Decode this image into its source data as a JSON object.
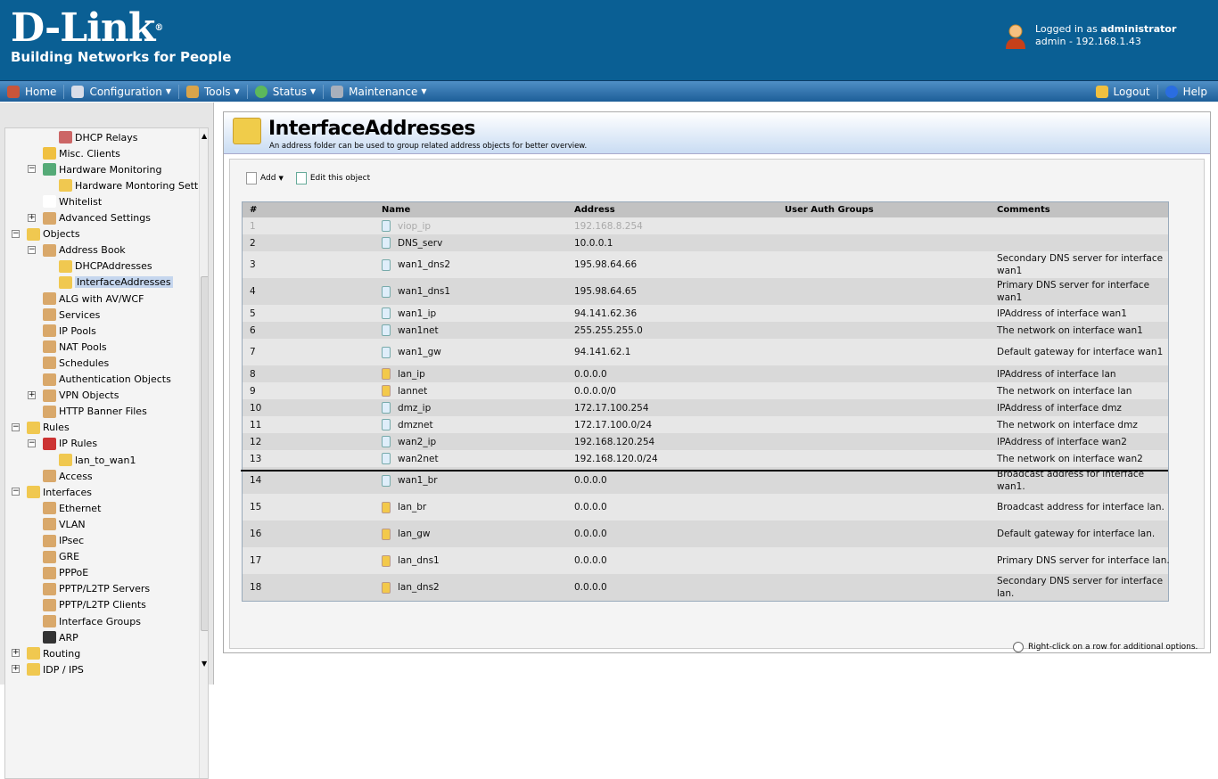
{
  "header": {
    "logo": "D-Link",
    "tagline": "Building Networks for People",
    "logged_in_prefix": "Logged in as ",
    "user": "administrator",
    "session": "admin - 192.168.1.43"
  },
  "nav": {
    "home": "Home",
    "configuration": "Configuration",
    "tools": "Tools",
    "status": "Status",
    "maintenance": "Maintenance",
    "logout": "Logout",
    "help": "Help"
  },
  "tree": [
    {
      "label": "DHCP Relays",
      "level": 3
    },
    {
      "label": "Misc. Clients",
      "level": 2
    },
    {
      "label": "Hardware Monitoring",
      "level": 2,
      "expander": "-"
    },
    {
      "label": "Hardware Montoring Settings",
      "level": 3
    },
    {
      "label": "Whitelist",
      "level": 2
    },
    {
      "label": "Advanced Settings",
      "level": 2,
      "expander": "+"
    },
    {
      "label": "Objects",
      "level": 1,
      "expander": "-"
    },
    {
      "label": "Address Book",
      "level": 2,
      "expander": "-"
    },
    {
      "label": "DHCPAddresses",
      "level": 3
    },
    {
      "label": "InterfaceAddresses",
      "level": 3,
      "selected": true
    },
    {
      "label": "ALG with AV/WCF",
      "level": 2
    },
    {
      "label": "Services",
      "level": 2
    },
    {
      "label": "IP Pools",
      "level": 2
    },
    {
      "label": "NAT Pools",
      "level": 2
    },
    {
      "label": "Schedules",
      "level": 2
    },
    {
      "label": "Authentication Objects",
      "level": 2
    },
    {
      "label": "VPN Objects",
      "level": 2,
      "expander": "+"
    },
    {
      "label": "HTTP Banner Files",
      "level": 2
    },
    {
      "label": "Rules",
      "level": 1,
      "expander": "-"
    },
    {
      "label": "IP Rules",
      "level": 2,
      "expander": "-"
    },
    {
      "label": "lan_to_wan1",
      "level": 3
    },
    {
      "label": "Access",
      "level": 2
    },
    {
      "label": "Interfaces",
      "level": 1,
      "expander": "-"
    },
    {
      "label": "Ethernet",
      "level": 2
    },
    {
      "label": "VLAN",
      "level": 2
    },
    {
      "label": "IPsec",
      "level": 2
    },
    {
      "label": "GRE",
      "level": 2
    },
    {
      "label": "PPPoE",
      "level": 2
    },
    {
      "label": "PPTP/L2TP Servers",
      "level": 2
    },
    {
      "label": "PPTP/L2TP Clients",
      "level": 2
    },
    {
      "label": "Interface Groups",
      "level": 2
    },
    {
      "label": "ARP",
      "level": 2
    },
    {
      "label": "Routing",
      "level": 1,
      "expander": "+"
    },
    {
      "label": "IDP / IPS",
      "level": 1,
      "expander": "+"
    }
  ],
  "page": {
    "title": "InterfaceAddresses",
    "description": "An address folder can be used to group related address objects for better overview.",
    "add": "Add",
    "edit": "Edit this object",
    "hint": "Right-click on a row for additional options."
  },
  "table": {
    "headers": [
      "#",
      "Name",
      "Address",
      "User Auth Groups",
      "Comments"
    ],
    "rows": [
      {
        "n": "1",
        "name": "viop_ip",
        "address": "192.168.8.254",
        "groups": "",
        "comment": "",
        "disabled": true
      },
      {
        "n": "2",
        "name": "DNS_serv",
        "address": "10.0.0.1",
        "groups": "",
        "comment": ""
      },
      {
        "n": "3",
        "name": "wan1_dns2",
        "address": "195.98.64.66",
        "groups": "",
        "comment": "Secondary DNS server for interface wan1"
      },
      {
        "n": "4",
        "name": "wan1_dns1",
        "address": "195.98.64.65",
        "groups": "",
        "comment": "Primary DNS server for interface wan1"
      },
      {
        "n": "5",
        "name": "wan1_ip",
        "address": "94.141.62.36",
        "groups": "",
        "comment": "IPAddress of interface wan1"
      },
      {
        "n": "6",
        "name": "wan1net",
        "address": "255.255.255.0",
        "groups": "",
        "comment": "The network on interface wan1"
      },
      {
        "n": "7",
        "name": "wan1_gw",
        "address": "94.141.62.1",
        "groups": "",
        "comment": "Default gateway for interface wan1"
      },
      {
        "n": "8",
        "name": "lan_ip",
        "address": "0.0.0.0",
        "groups": "",
        "comment": "IPAddress of interface lan",
        "lan": true
      },
      {
        "n": "9",
        "name": "lannet",
        "address": "0.0.0.0/0",
        "groups": "",
        "comment": "The network on interface lan",
        "lan": true
      },
      {
        "n": "10",
        "name": "dmz_ip",
        "address": "172.17.100.254",
        "groups": "",
        "comment": "IPAddress of interface dmz"
      },
      {
        "n": "11",
        "name": "dmznet",
        "address": "172.17.100.0/24",
        "groups": "",
        "comment": "The network on interface dmz"
      },
      {
        "n": "12",
        "name": "wan2_ip",
        "address": "192.168.120.254",
        "groups": "",
        "comment": "IPAddress of interface wan2"
      },
      {
        "n": "13",
        "name": "wan2net",
        "address": "192.168.120.0/24",
        "groups": "",
        "comment": "The network on interface wan2"
      },
      {
        "n": "14",
        "name": "wan1_br",
        "address": "0.0.0.0",
        "groups": "",
        "comment": "Broadcast address for interface wan1."
      },
      {
        "n": "15",
        "name": "lan_br",
        "address": "0.0.0.0",
        "groups": "",
        "comment": "Broadcast address for interface lan.",
        "lan": true
      },
      {
        "n": "16",
        "name": "lan_gw",
        "address": "0.0.0.0",
        "groups": "",
        "comment": "Default gateway for interface lan.",
        "lan": true
      },
      {
        "n": "17",
        "name": "lan_dns1",
        "address": "0.0.0.0",
        "groups": "",
        "comment": "Primary DNS server for interface lan.",
        "lan": true
      },
      {
        "n": "18",
        "name": "lan_dns2",
        "address": "0.0.0.0",
        "groups": "",
        "comment": "Secondary DNS server for interface lan.",
        "lan": true
      }
    ]
  }
}
